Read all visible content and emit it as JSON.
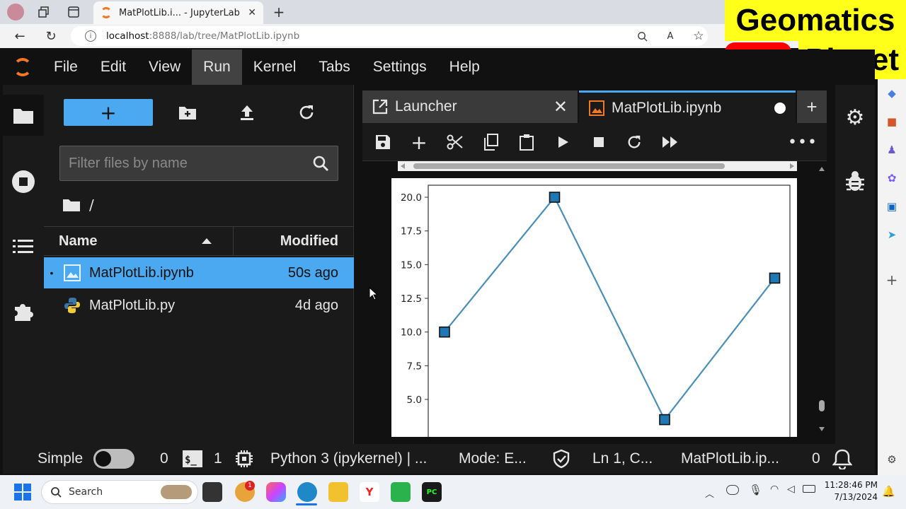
{
  "browser": {
    "tab_title": "MatPlotLib.i... - JupyterLab",
    "address_host": "localhost",
    "address_path": ":8888/lab/tree/MatPlotLib.ipynb"
  },
  "watermark": {
    "line1": "Geomatics",
    "line2": "Planet"
  },
  "menubar": {
    "items": [
      "File",
      "Edit",
      "View",
      "Run",
      "Kernel",
      "Tabs",
      "Settings",
      "Help"
    ],
    "active": "Run"
  },
  "file_browser": {
    "filter_placeholder": "Filter files by name",
    "breadcrumb": "/",
    "col_name": "Name",
    "col_modified": "Modified",
    "files": [
      {
        "name": "MatPlotLib.ipynb",
        "modified": "50s ago",
        "selected": true,
        "dot": "•"
      },
      {
        "name": "MatPlotLib.py",
        "modified": "4d ago",
        "selected": false,
        "dot": ""
      }
    ]
  },
  "dock": {
    "tab_launcher": "Launcher",
    "tab_notebook": "MatPlotLib.ipynb"
  },
  "chart_data": {
    "type": "line",
    "x": [
      0,
      1,
      2,
      3
    ],
    "values": [
      10,
      20,
      3.5,
      14
    ],
    "yticks": [
      "20.0",
      "17.5",
      "15.0",
      "12.5",
      "10.0",
      "7.5",
      "5.0"
    ],
    "ylim_visible": [
      3.5,
      20.8
    ],
    "marker": "square",
    "line_color": "#4a8fb8",
    "marker_color": "#1f77b4"
  },
  "status": {
    "mode_label": "Simple",
    "terminals_count": "0",
    "kernels_count": "1",
    "kernel": "Python 3 (ipykernel) | ...",
    "mode": "Mode: E...",
    "position": "Ln 1, C...",
    "filename": "MatPlotLib.ip...",
    "notifications": "0"
  },
  "taskbar": {
    "search": "Search",
    "time": "11:28:46 PM",
    "date": "7/13/2024",
    "badge": "1"
  }
}
